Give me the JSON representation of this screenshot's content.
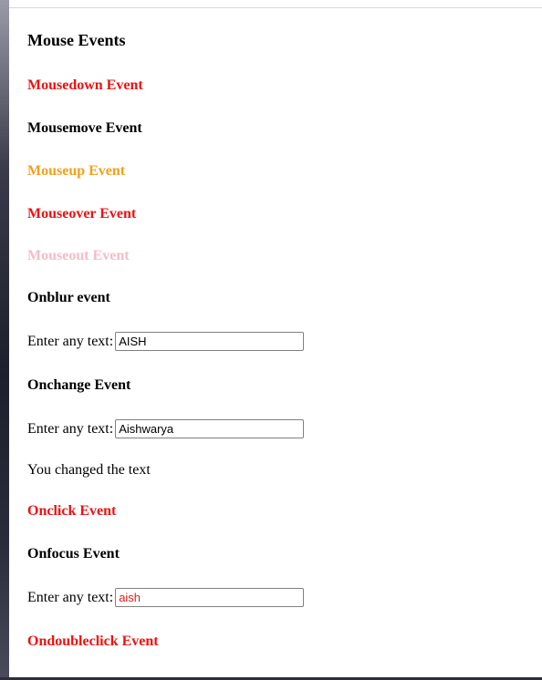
{
  "title": "Mouse Events",
  "events": [
    {
      "label": "Mousedown Event",
      "color": "#ee1111"
    },
    {
      "label": "Mousemove Event",
      "color": "#000000"
    },
    {
      "label": "Mouseup Event",
      "color": "#f3a01c"
    },
    {
      "label": "Mouseover Event",
      "color": "#ee1111"
    },
    {
      "label": "Mouseout Event",
      "color": "#f6bcc8"
    }
  ],
  "onblur": {
    "heading": "Onblur event",
    "label": "Enter any text:",
    "value": "AISH"
  },
  "onchange": {
    "heading": "Onchange Event",
    "label": "Enter any text:",
    "value": "Aishwarya",
    "message": "You changed the text"
  },
  "onclick": {
    "heading": "Onclick Event",
    "color": "#ee1111"
  },
  "onfocus": {
    "heading": "Onfocus Event",
    "label": "Enter any text:",
    "value": "aish",
    "value_color": "#e02020"
  },
  "ondoubleclick": {
    "heading": "Ondoubleclick Event",
    "color": "#ee1111"
  }
}
